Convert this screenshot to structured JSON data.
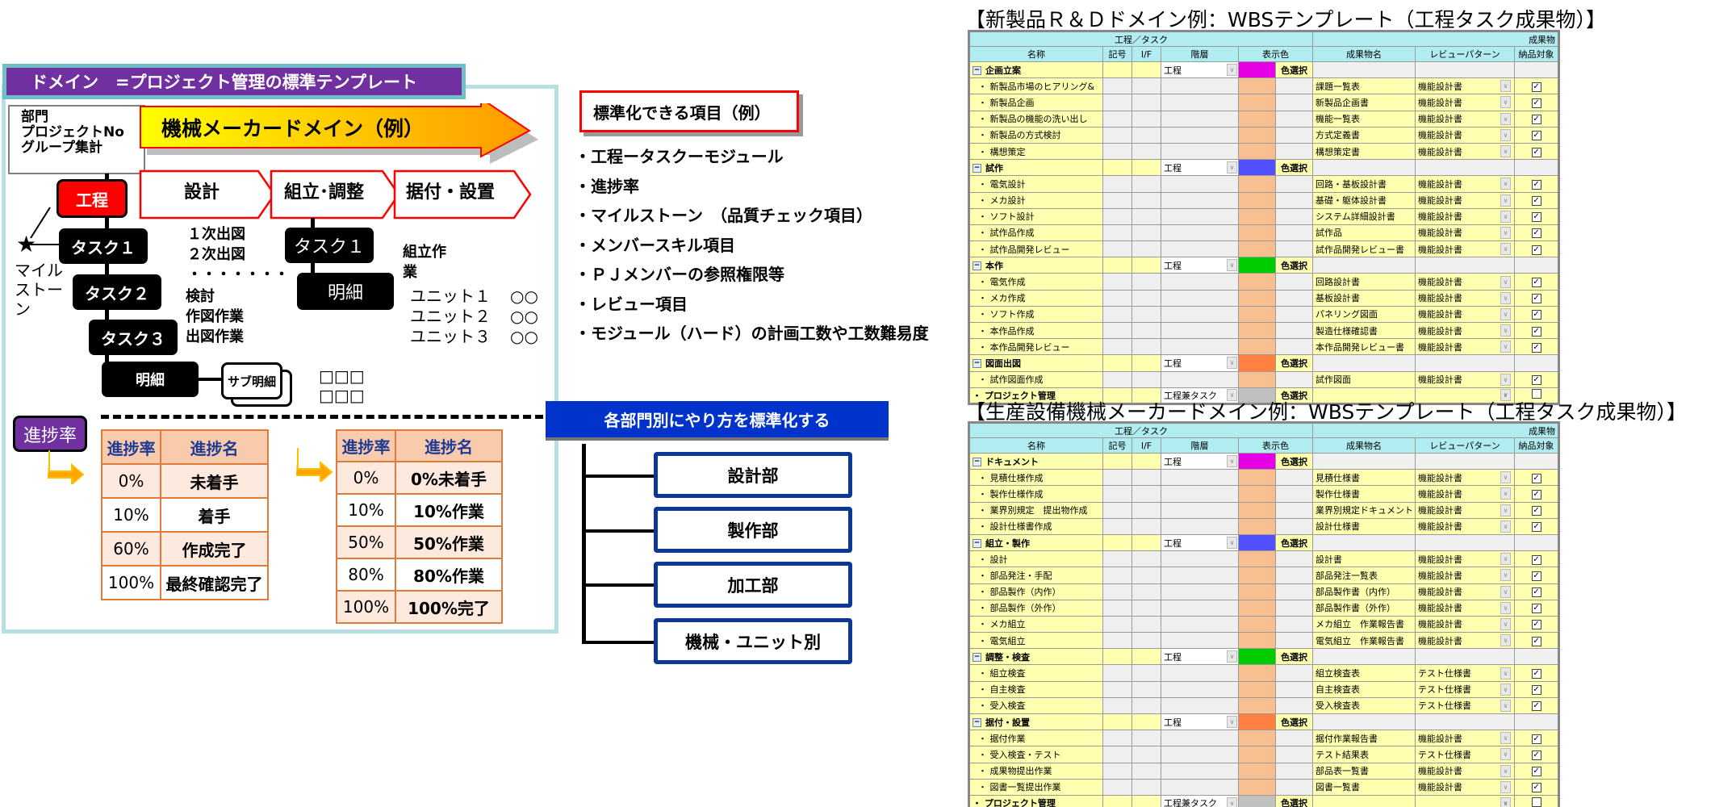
{
  "left_panel": {
    "domain_banner": "ドメイン　=プロジェクト管理の標準テンプレート",
    "dept_box": [
      "部門",
      "プロジェクトNo",
      "グループ集計"
    ],
    "maker_arrow_label": "機械メーカードメイン（例）",
    "phases": [
      "設計",
      "組立･調整",
      "据付・設置"
    ],
    "koutei": "工程",
    "milestone_label": [
      "マイル",
      "ストー",
      "ン"
    ],
    "milestone_icon": "star-icon",
    "tasks": [
      "タスク１",
      "タスク２",
      "タスク３"
    ],
    "detail": "明細",
    "sub_detail": "サブ明細",
    "task1_notes": [
      "１次出図",
      "２次出図",
      "・・・・・・・"
    ],
    "task2_notes": [
      "検討",
      "作図作業",
      "出図作業"
    ],
    "sub_detail_marks": [
      "□□□",
      "□□□"
    ],
    "assembly": {
      "task": "タスク１",
      "detail": "明細",
      "note": [
        "組立作",
        "業"
      ],
      "units": [
        {
          "name": "ユニット１",
          "mark": "○○"
        },
        {
          "name": "ユニット２",
          "mark": "○○"
        },
        {
          "name": "ユニット３",
          "mark": "○○"
        }
      ]
    },
    "progress_badge": "進捗率",
    "progress_table_a": {
      "headers": [
        "進捗率",
        "進捗名"
      ],
      "rows": [
        [
          "0%",
          "未着手"
        ],
        [
          "10%",
          "着手"
        ],
        [
          "60%",
          "作成完了"
        ],
        [
          "100%",
          "最終確認完了"
        ]
      ]
    },
    "progress_table_b": {
      "headers": [
        "進捗率",
        "進捗名"
      ],
      "rows": [
        [
          "0%",
          "0%未着手"
        ],
        [
          "10%",
          "10%作業"
        ],
        [
          "50%",
          "50%作業"
        ],
        [
          "80%",
          "80%作業"
        ],
        [
          "100%",
          "100%完了"
        ]
      ]
    }
  },
  "standard_items": {
    "title": "標準化できる項目（例）",
    "items": [
      "・工程ータスクーモジュール",
      "・進捗率",
      "・マイルストーン　（品質チェック項目）",
      "・メンバースキル項目",
      "・ＰＪメンバーの参照権限等",
      "・レビュー項目",
      "・モジュール（ハード）の計画工数や工数難易度"
    ]
  },
  "departments": {
    "banner": "各部門別にやり方を標準化する",
    "nodes": [
      "設計部",
      "製作部",
      "加工部",
      "機械・ユニット別"
    ]
  },
  "wbs_common": {
    "group_header_left": "工程／タスク",
    "group_header_right": "成果物",
    "columns": [
      "名称",
      "記号",
      "I/F",
      "階層",
      "表示色",
      "成果物名",
      "レビューパターン",
      "納品対象"
    ],
    "color_button": "色選択",
    "task_swatch_color": "#f8c090",
    "pm_swatch_color": "#c0c0c0"
  },
  "wbs_rnd": {
    "title": "【新製品Ｒ＆Ｄドメイン例：WBSテンプレート（工程タスク成果物）】",
    "rows": [
      {
        "type": "proc",
        "name": "企画立案",
        "level": "工程",
        "color": "#e600e6"
      },
      {
        "type": "task",
        "name": "新製品市場のヒアリング&",
        "deliverable": "課題一覧表",
        "review": "機能設計書",
        "checked": true
      },
      {
        "type": "task",
        "name": "新製品企画",
        "deliverable": "新製品企画書",
        "review": "機能設計書",
        "checked": true
      },
      {
        "type": "task",
        "name": "新製品の機能の洗い出し",
        "deliverable": "機能一覧表",
        "review": "機能設計書",
        "checked": true
      },
      {
        "type": "task",
        "name": "新製品の方式検討",
        "deliverable": "方式定義書",
        "review": "機能設計書",
        "checked": true
      },
      {
        "type": "task",
        "name": "構想策定",
        "deliverable": "構想策定書",
        "review": "機能設計書",
        "checked": true
      },
      {
        "type": "proc",
        "name": "試作",
        "level": "工程",
        "color": "#5050ff"
      },
      {
        "type": "task",
        "name": "電気設計",
        "deliverable": "回路・基板設計書",
        "review": "機能設計書",
        "checked": true
      },
      {
        "type": "task",
        "name": "メカ設計",
        "deliverable": "基礎・躯体設計書",
        "review": "機能設計書",
        "checked": true
      },
      {
        "type": "task",
        "name": "ソフト設計",
        "deliverable": "システム詳細設計書",
        "review": "機能設計書",
        "checked": true
      },
      {
        "type": "task",
        "name": "試作品作成",
        "deliverable": "試作品",
        "review": "機能設計書",
        "checked": true
      },
      {
        "type": "task",
        "name": "試作品開発レビュー",
        "deliverable": "試作品開発レビュー書",
        "review": "機能設計書",
        "checked": true
      },
      {
        "type": "proc",
        "name": "本作",
        "level": "工程",
        "color": "#00cc00"
      },
      {
        "type": "task",
        "name": "電気作成",
        "deliverable": "回路設計書",
        "review": "機能設計書",
        "checked": true
      },
      {
        "type": "task",
        "name": "メカ作成",
        "deliverable": "基板設計書",
        "review": "機能設計書",
        "checked": true
      },
      {
        "type": "task",
        "name": "ソフト作成",
        "deliverable": "パネリング図面",
        "review": "機能設計書",
        "checked": true
      },
      {
        "type": "task",
        "name": "本作品作成",
        "deliverable": "製造仕様確認書",
        "review": "機能設計書",
        "checked": true
      },
      {
        "type": "task",
        "name": "本作品開発レビュー",
        "deliverable": "本作品開発レビュー書",
        "review": "機能設計書",
        "checked": true
      },
      {
        "type": "proc",
        "name": "図面出図",
        "level": "工程",
        "color": "#ff8040"
      },
      {
        "type": "task",
        "name": "試作図面作成",
        "deliverable": "試作図面",
        "review": "機能設計書",
        "checked": true
      },
      {
        "type": "pm",
        "name": "プロジェクト管理",
        "level": "工程兼タスク",
        "deliverable": "",
        "review": "",
        "checked": false
      }
    ]
  },
  "wbs_machine": {
    "title": "【生産設備機械メーカードメイン例：WBSテンプレート（工程タスク成果物）】",
    "rows": [
      {
        "type": "proc",
        "name": "ドキュメント",
        "level": "工程",
        "color": "#e600e6"
      },
      {
        "type": "task",
        "name": "見積仕様作成",
        "deliverable": "見積仕様書",
        "review": "機能設計書",
        "checked": true
      },
      {
        "type": "task",
        "name": "製作仕様作成",
        "deliverable": "製作仕様書",
        "review": "機能設計書",
        "checked": true
      },
      {
        "type": "task",
        "name": "業界別規定　提出物作成",
        "deliverable": "業界別規定ドキュメント",
        "review": "機能設計書",
        "checked": true
      },
      {
        "type": "task",
        "name": "設計仕様書作成",
        "deliverable": "設計仕様書",
        "review": "機能設計書",
        "checked": true
      },
      {
        "type": "proc",
        "name": "組立・製作",
        "level": "工程",
        "color": "#5050ff"
      },
      {
        "type": "task",
        "name": "設計",
        "deliverable": "設計書",
        "review": "機能設計書",
        "checked": true
      },
      {
        "type": "task",
        "name": "部品発注・手配",
        "deliverable": "部品発注一覧表",
        "review": "機能設計書",
        "checked": true
      },
      {
        "type": "task",
        "name": "部品製作（内作）",
        "deliverable": "部品製作書（内作）",
        "review": "機能設計書",
        "checked": true
      },
      {
        "type": "task",
        "name": "部品製作（外作）",
        "deliverable": "部品製作書（外作）",
        "review": "機能設計書",
        "checked": true
      },
      {
        "type": "task",
        "name": "メカ組立",
        "deliverable": "メカ組立　作業報告書",
        "review": "機能設計書",
        "checked": true
      },
      {
        "type": "task",
        "name": "電気組立",
        "deliverable": "電気組立　作業報告書",
        "review": "機能設計書",
        "checked": true
      },
      {
        "type": "proc",
        "name": "調整・検査",
        "level": "工程",
        "color": "#00cc00"
      },
      {
        "type": "task",
        "name": "組立検査",
        "deliverable": "組立検査表",
        "review": "テスト仕様書",
        "checked": true
      },
      {
        "type": "task",
        "name": "自主検査",
        "deliverable": "自主検査表",
        "review": "テスト仕様書",
        "checked": true
      },
      {
        "type": "task",
        "name": "受入検査",
        "deliverable": "受入検査表",
        "review": "テスト仕様書",
        "checked": true
      },
      {
        "type": "proc",
        "name": "据付・設置",
        "level": "工程",
        "color": "#ff8040"
      },
      {
        "type": "task",
        "name": "据付作業",
        "deliverable": "据付作業報告書",
        "review": "機能設計書",
        "checked": true
      },
      {
        "type": "task",
        "name": "受入検査・テスト",
        "deliverable": "テスト結果表",
        "review": "テスト仕様書",
        "checked": true
      },
      {
        "type": "task",
        "name": "成果物提出作業",
        "deliverable": "部品表一覧書",
        "review": "機能設計書",
        "checked": true
      },
      {
        "type": "task",
        "name": "図書一覧提出作業",
        "deliverable": "図書一覧書",
        "review": "機能設計書",
        "checked": true
      },
      {
        "type": "pm",
        "name": "プロジェクト管理",
        "level": "工程兼タスク",
        "deliverable": "",
        "review": "",
        "checked": false
      }
    ]
  }
}
